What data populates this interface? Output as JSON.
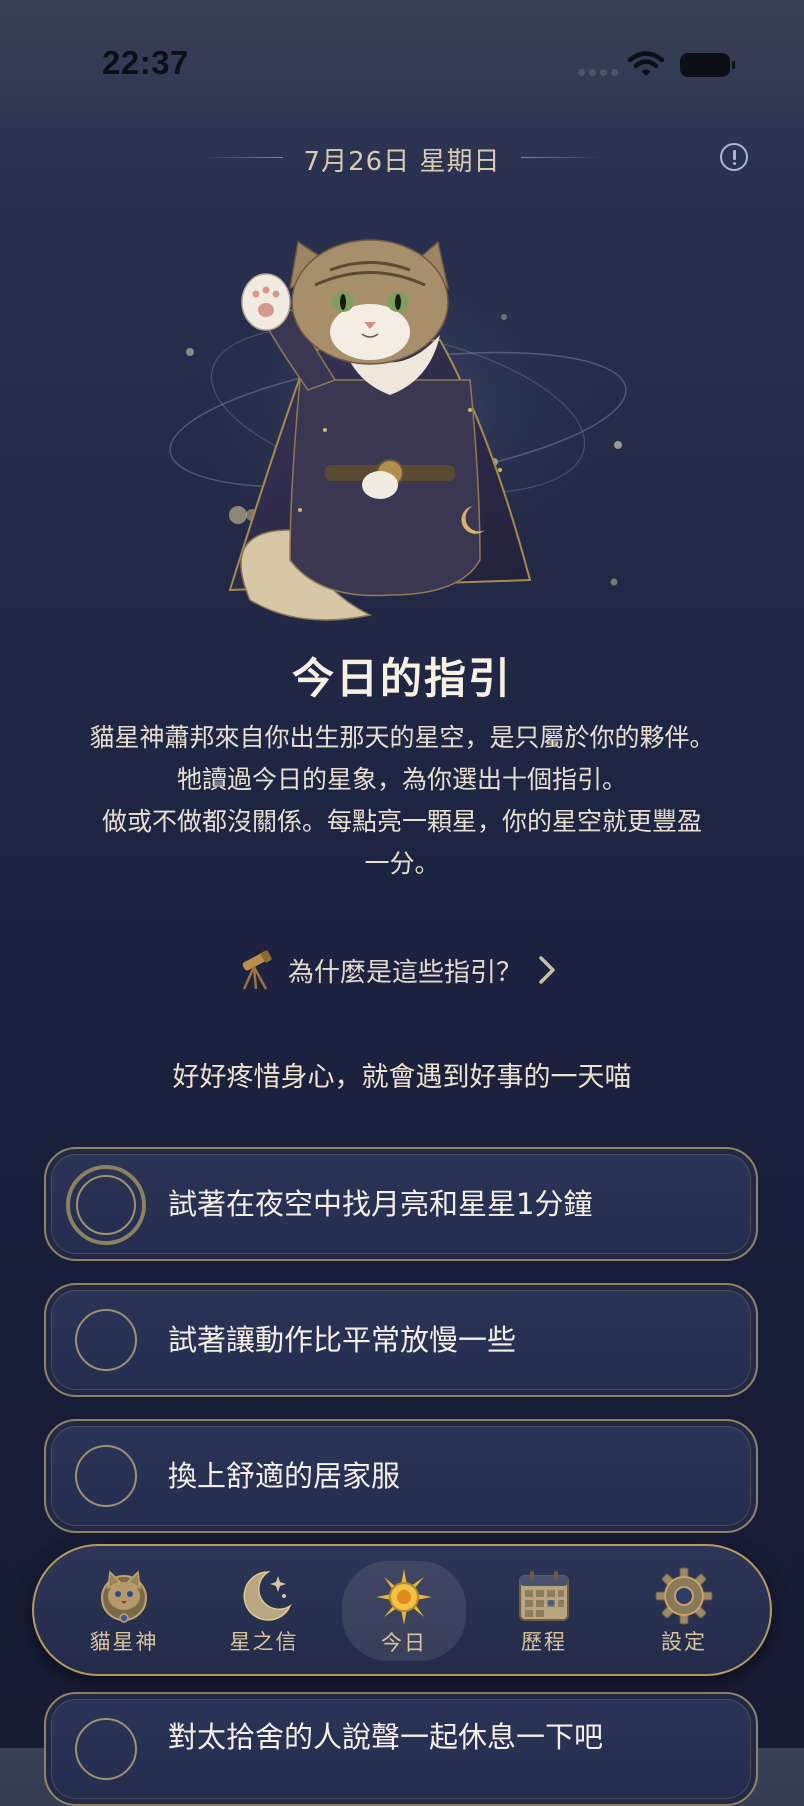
{
  "status_bar": {
    "time": "22:37"
  },
  "header": {
    "date": "7月26日 星期日"
  },
  "hero": {
    "title": "今日的指引",
    "intro_lines": [
      "貓星神蕭邦來自你出生那天的星空，是只屬於你的夥伴。",
      "牠讀過今日的星象，為你選出十個指引。",
      "做或不做都沒關係。每點亮一顆星，你的星空就更豐盈",
      "一分。"
    ]
  },
  "why_link": {
    "label": "為什麼是這些指引？"
  },
  "tagline": "好好疼惜身心，就會遇到好事的一天喵",
  "tasks": [
    {
      "label": "試著在夜空中找月亮和星星1分鐘",
      "done": false
    },
    {
      "label": "試著讓動作比平常放慢一些",
      "done": false
    },
    {
      "label": "換上舒適的居家服",
      "done": false
    },
    {
      "label": "對太拾舍的人說聲一起休息一下吧",
      "done": false
    }
  ],
  "tabs": [
    {
      "label": "貓星神",
      "icon": "cat-emblem-icon"
    },
    {
      "label": "星之信",
      "icon": "crescent-moon-icon"
    },
    {
      "label": "今日",
      "icon": "sun-icon",
      "active": true
    },
    {
      "label": "歷程",
      "icon": "calendar-icon"
    },
    {
      "label": "設定",
      "icon": "gear-icon"
    }
  ],
  "colors": {
    "accent_gold": "#b59a5d",
    "text_cream": "#efe6d4",
    "info_blue": "#a6b6dc"
  }
}
